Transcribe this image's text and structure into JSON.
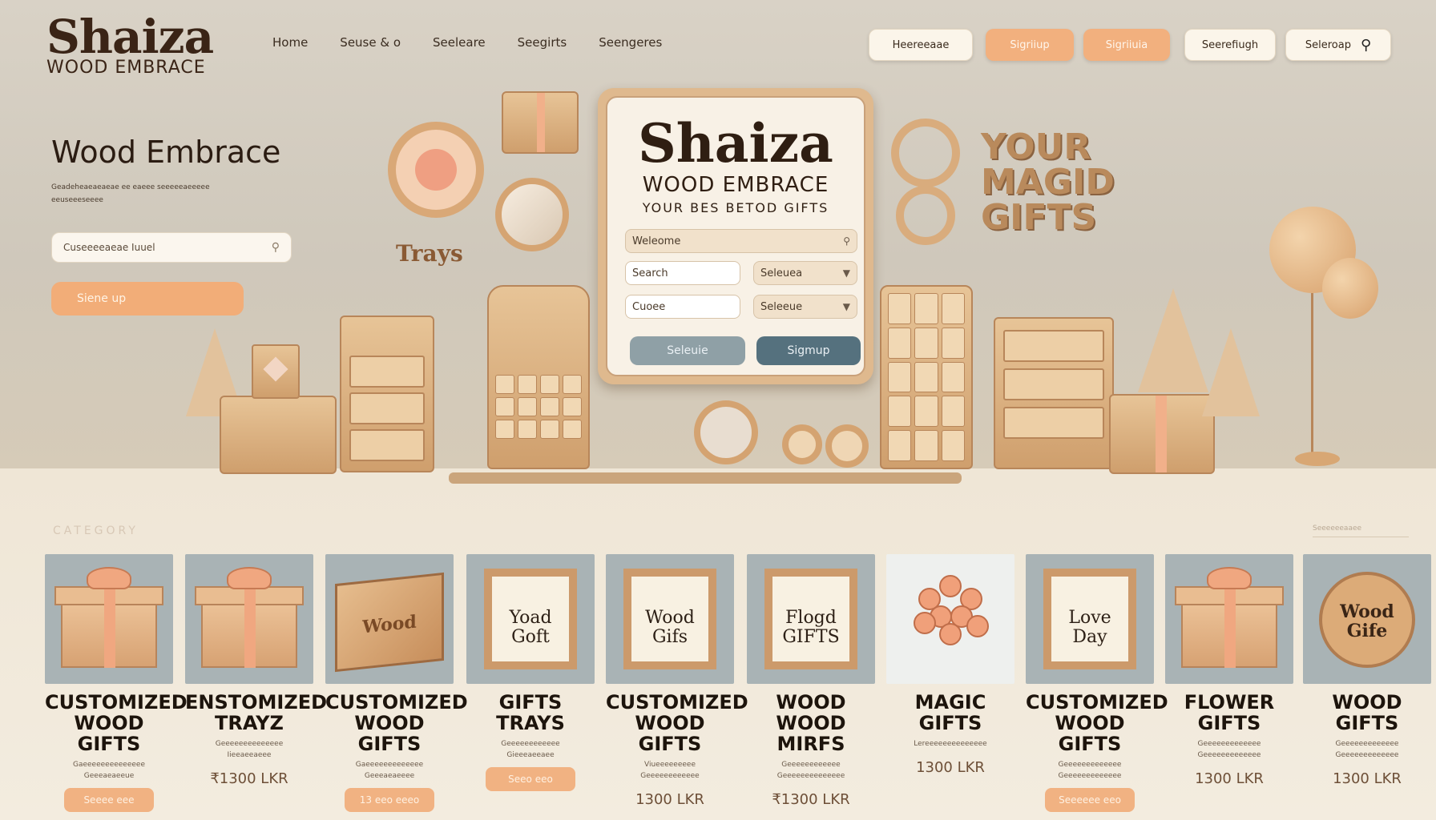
{
  "header": {
    "logo_main": "Shaiza",
    "logo_sub": "WOOD EMBRACE",
    "nav": [
      "Home",
      "Seuse & o",
      "Seeleare",
      "Seegirts",
      "Seengeres"
    ],
    "buttons": [
      {
        "label": "Heereeaae",
        "style": "light"
      },
      {
        "label": "Sigriiup",
        "style": "orange"
      },
      {
        "label": "Sigriiuia",
        "style": "orange"
      },
      {
        "label": "Seerefiugh",
        "style": "light"
      },
      {
        "label": "Seleroap",
        "style": "light",
        "icon": "search-icon"
      }
    ]
  },
  "hero": {
    "title": "Wood Embrace",
    "text": "Geadeheaeaeaeae ee eaeee seeeeeaeeeee eeuseeeseeee",
    "input_value": "Cuseeeeaeae Iuuel",
    "signup_label": "Siene up"
  },
  "card": {
    "title": "Shaiza",
    "subtitle": "WOOD EMBRACE",
    "tagline": "YOUR BES BETOD GIFTS",
    "welcome_field": "Weleome",
    "search_field": "Search",
    "select1": "Seleuea",
    "field3": "Cuoee",
    "select2": "Seleeue",
    "btn_login": "Seleuie",
    "btn_signup": "Sigmup"
  },
  "decor": {
    "trays_label": "Trays",
    "magic_text": [
      "YOUR",
      "MAGID",
      "GIFTS"
    ]
  },
  "categories": {
    "heading": "CATEGORY",
    "right_link": "Seeeeeeaaee",
    "items": [
      {
        "name": "CUSTOMIZED\nWOOD GIFTS",
        "desc": "Gaeeeeeeeeeeeeee\nGeeeaeaeeue",
        "price": "Seeee eee",
        "price_style": "orange",
        "img": "gift-box",
        "img_text": ""
      },
      {
        "name": "ENSTOMIZED\nTRAYZ",
        "desc": "Geeeeeeeeeeeeee\nIieeaeeaeee",
        "price": "₹1300 LKR",
        "price_style": "plain",
        "img": "gift-box",
        "img_text": ""
      },
      {
        "name": "CUSTOMIZED\nWOOD GIFTS",
        "desc": "Gaeeeeeeeeeeeee\nGeeeaeaeeee",
        "price": "13 eeo eeeo",
        "price_style": "orange",
        "img": "crate",
        "img_text": "Wood"
      },
      {
        "name": "GIFTS\nTRAYS",
        "desc": "Geeeeeeeeeeee\nGieeeaeeaee",
        "price": "Seeo eeo",
        "price_style": "orange",
        "img": "frame",
        "img_text": "Yoad\nGoft"
      },
      {
        "name": "CUSTOMIZED\nWOOD GIFTS",
        "desc": "Viueeeeeeeee\nGeeeeeeeeeeee",
        "price": "1300 LKR",
        "price_style": "plain",
        "img": "frame",
        "img_text": "Wood\nGifs"
      },
      {
        "name": "WOOD\nWOOD MIRFS",
        "desc": "Geeeeeeeeeeee\nGeeeeeeeeeeeeee",
        "price": "₹1300 LKR",
        "price_style": "plain",
        "img": "frame",
        "img_text": "Flogd\nGIFTS"
      },
      {
        "name": "MAGIC\nGIFTS",
        "desc": "Lereeeeeeeeeeeeee",
        "price": "1300 LKR",
        "price_style": "plain",
        "img": "flowers",
        "img_text": ""
      },
      {
        "name": "CUSTOMIZED\nWOOD GIFTS",
        "desc": "Geeeeeeeeeeeee\nGeeeeeeeeeeeee",
        "price": "Seeeeee eeo",
        "price_style": "orange",
        "img": "frame",
        "img_text": "Love\nDay"
      },
      {
        "name": "FLOWER\nGIFTS",
        "desc": "Geeeeeeeeeeeee\nGeeeeeeeeeeeee",
        "price": "1300 LKR",
        "price_style": "plain",
        "img": "gift-box",
        "img_text": ""
      },
      {
        "name": "WOOD\nGIFTS",
        "desc": "Geeeeeeeeeeeee\nGeeeeeeeeeeeee",
        "price": "1300 LKR",
        "price_style": "plain",
        "img": "disc",
        "img_text": "Wood\nGife"
      }
    ]
  },
  "colors": {
    "accent": "#f2b07e",
    "background": "#efe6d8",
    "dark_text": "#2b1c12",
    "card_btn_dark": "#55717e",
    "card_btn_gray": "#8fa0a6"
  }
}
